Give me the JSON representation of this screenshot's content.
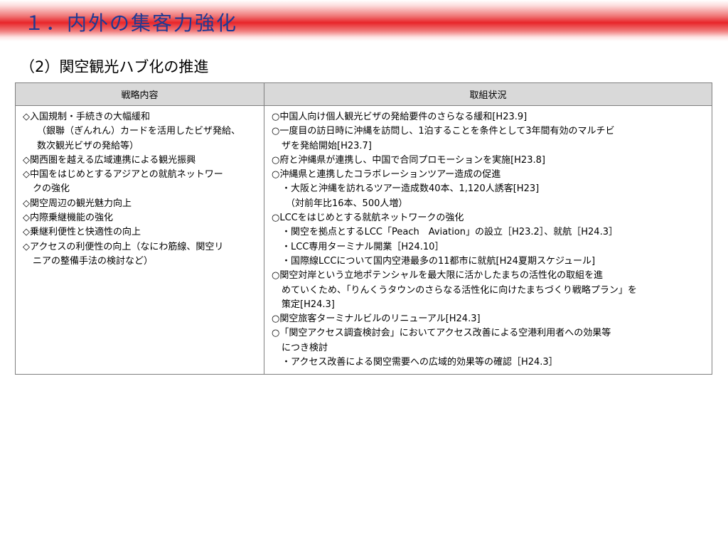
{
  "slide": {
    "title": "１．内外の集客力強化",
    "subtitle": "（2）関空観光ハブ化の推進"
  },
  "table": {
    "headers": [
      "戦略内容",
      "取組状況"
    ],
    "left_lines": [
      {
        "text": "◇入国規制・手続きの大幅緩和",
        "indent": 0
      },
      {
        "text": "（銀聯（ぎんれん）カードを活用したビザ発給、",
        "indent": 2
      },
      {
        "text": "数次観光ビザの発給等）",
        "indent": 2
      },
      {
        "text": "◇関西圏を越える広域連携による観光振興",
        "indent": 0
      },
      {
        "text": "◇中国をはじめとするアジアとの就航ネットワー",
        "indent": 0
      },
      {
        "text": "クの強化",
        "indent": 1
      },
      {
        "text": "◇関空周辺の観光魅力向上",
        "indent": 0
      },
      {
        "text": "◇内際乗継機能の強化",
        "indent": 0
      },
      {
        "text": "◇乗継利便性と快適性の向上",
        "indent": 0
      },
      {
        "text": "◇アクセスの利便性の向上（なにわ筋線、関空リ",
        "indent": 0
      },
      {
        "text": "ニアの整備手法の検討など）",
        "indent": 1
      }
    ],
    "right_lines": [
      {
        "text": "○中国人向け個人観光ビザの発給要件のさらなる緩和[H23.9]",
        "indent": 0
      },
      {
        "text": "○一度目の訪日時に沖縄を訪問し、1泊することを条件として3年間有効のマルチビ",
        "indent": 0
      },
      {
        "text": "ザを発給開始[H23.7]",
        "indent": 1
      },
      {
        "text": "○府と沖縄県が連携し、中国で合同プロモーションを実施[H23.8]",
        "indent": 0
      },
      {
        "text": "○沖縄県と連携したコラボレーションツアー造成の促進",
        "indent": 0
      },
      {
        "text": "・大阪と沖縄を訪れるツアー造成数40本、1,120人誘客[H23]",
        "indent": 1
      },
      {
        "text": "（対前年比16本、500人増）",
        "indent": 2
      },
      {
        "text": "○LCCをはじめとする就航ネットワークの強化",
        "indent": 0
      },
      {
        "text": "・関空を拠点とするLCC「Peach　Aviation」の設立［H23.2］、就航［H24.3］",
        "indent": 1
      },
      {
        "text": "・LCC専用ターミナル開業［H24.10］",
        "indent": 1
      },
      {
        "text": "・国際線LCCについて国内空港最多の11都市に就航[H24夏期スケジュール]",
        "indent": 1
      },
      {
        "text": "○関空対岸という立地ポテンシャルを最大限に活かしたまちの活性化の取組を進",
        "indent": 0
      },
      {
        "text": "めていくため、「りんくうタウンのさらなる活性化に向けたまちづくり戦略プラン」を",
        "indent": 1
      },
      {
        "text": "策定[H24.3]",
        "indent": 1
      },
      {
        "text": "○関空旅客ターミナルビルのリニューアル[H24.3]",
        "indent": 0
      },
      {
        "text": "○「関空アクセス調査検討会」においてアクセス改善による空港利用者への効果等",
        "indent": 0
      },
      {
        "text": "につき検討",
        "indent": 1
      },
      {
        "text": "・アクセス改善による関空需要への広域的効果等の確認［H24.3］",
        "indent": 1
      }
    ]
  }
}
